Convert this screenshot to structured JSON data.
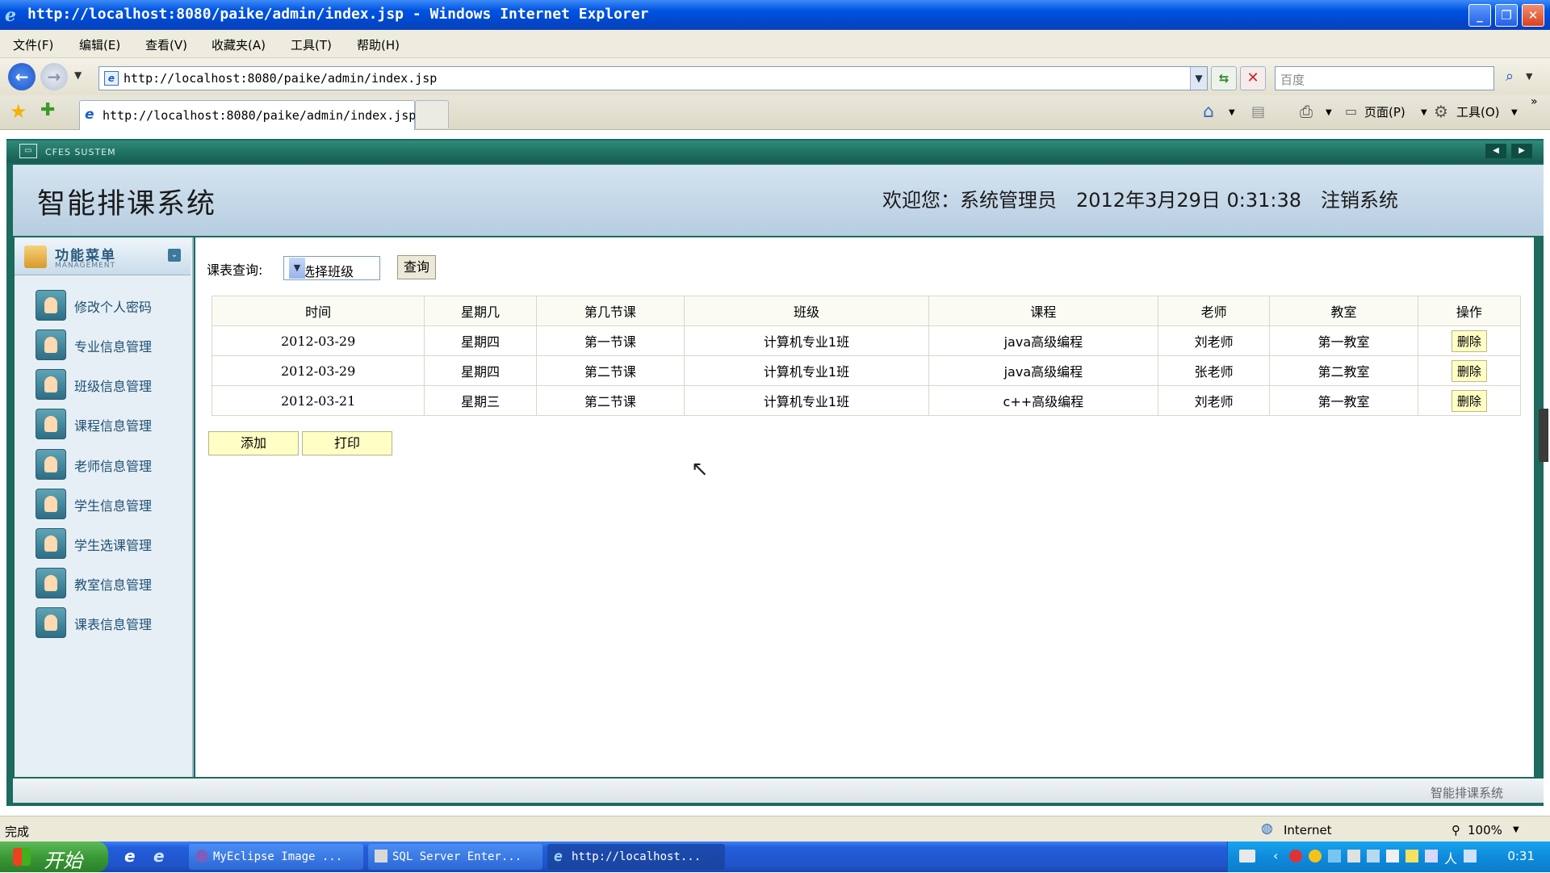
{
  "browser": {
    "title": "http://localhost:8080/paike/admin/index.jsp - Windows Internet Explorer",
    "menu": [
      "文件(F)",
      "编辑(E)",
      "查看(V)",
      "收藏夹(A)",
      "工具(T)",
      "帮助(H)"
    ],
    "address": "http://localhost:8080/paike/admin/index.jsp",
    "search_placeholder": "百度",
    "tab_title": "http://localhost:8080/paike/admin/index.jsp",
    "toolbar_page": "页面(P)",
    "toolbar_tools": "工具(O)",
    "status_left": "完成",
    "status_zone": "Internet",
    "status_zoom": "100%"
  },
  "frame": {
    "header_label": "CFES SUSTEM"
  },
  "app": {
    "title": "智能排课系统",
    "welcome": "欢迎您：系统管理员　2012年3月29日 0:31:38　注销系统",
    "footer": "智能排课系统"
  },
  "sidebar": {
    "title": "功能菜单",
    "subtitle": "MANAGEMENT",
    "items": [
      {
        "label": "修改个人密码"
      },
      {
        "label": "专业信息管理"
      },
      {
        "label": "班级信息管理"
      },
      {
        "label": "课程信息管理"
      },
      {
        "label": "老师信息管理"
      },
      {
        "label": "学生信息管理"
      },
      {
        "label": "学生选课管理"
      },
      {
        "label": "教室信息管理"
      },
      {
        "label": "课表信息管理"
      }
    ]
  },
  "query": {
    "label": "课表查询:",
    "select_value": "请选择班级",
    "button": "查询"
  },
  "table": {
    "headers": [
      "时间",
      "星期几",
      "第几节课",
      "班级",
      "课程",
      "老师",
      "教室",
      "操作"
    ],
    "rows": [
      [
        "2012-03-29",
        "星期四",
        "第一节课",
        "计算机专业1班",
        "java高级编程",
        "刘老师",
        "第一教室",
        "删除"
      ],
      [
        "2012-03-29",
        "星期四",
        "第二节课",
        "计算机专业1班",
        "java高级编程",
        "张老师",
        "第二教室",
        "删除"
      ],
      [
        "2012-03-21",
        "星期三",
        "第二节课",
        "计算机专业1班",
        "c++高级编程",
        "刘老师",
        "第一教室",
        "删除"
      ]
    ]
  },
  "actions": {
    "add": "添加",
    "print": "打印"
  },
  "taskbar": {
    "start": "开始",
    "tasks": [
      "MyEclipse Image ...",
      "SQL Server Enter...",
      "http://localhost..."
    ],
    "clock": "0:31"
  }
}
